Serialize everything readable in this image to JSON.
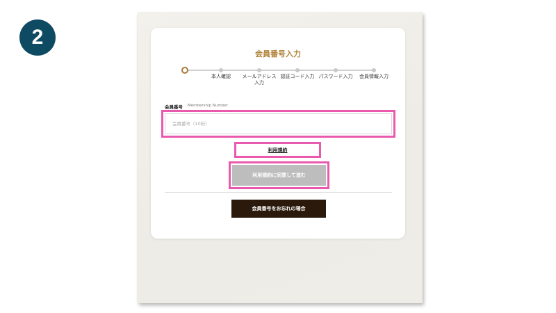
{
  "badge": {
    "number": "2"
  },
  "colors": {
    "accent": "#b08238",
    "highlight": "#e95aae",
    "badge": "#0f4a63",
    "dark_button": "#2b1a0b"
  },
  "form": {
    "title": "会員番号入力",
    "steps": [
      "本人確認",
      "メールアドレス\n入力",
      "認証コード入力",
      "パスワード入力",
      "会員情報入力"
    ],
    "current_step": 0,
    "field_label": "会員番号",
    "field_label_sub": "Membership Number",
    "input_placeholder": "会員番号（10桁）",
    "input_value": "",
    "terms_link": "利用規約",
    "agree_button": "利用規約に同意して進む",
    "forgot_button": "会員番号をお忘れの場合"
  }
}
